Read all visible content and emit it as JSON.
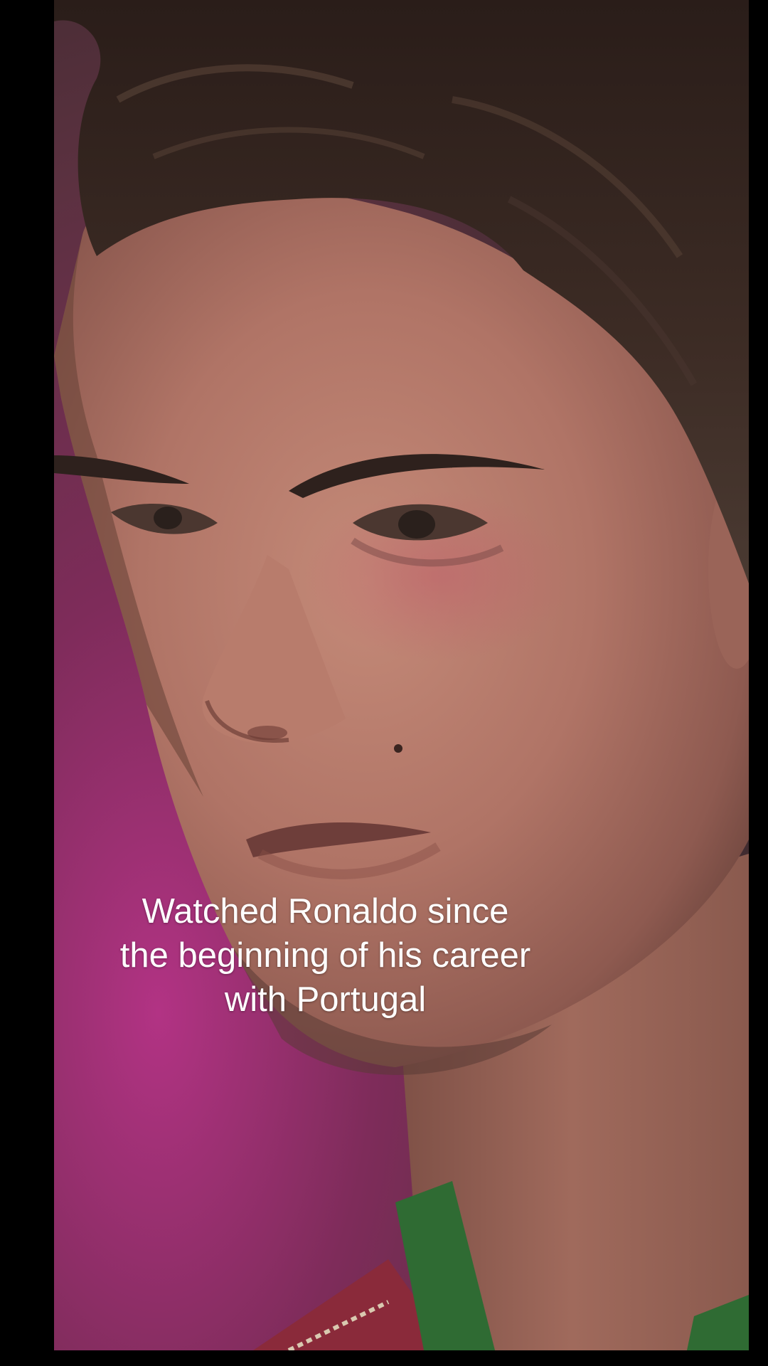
{
  "video": {
    "caption_lines": [
      "Watched Ronaldo since",
      "the beginning of his career",
      "with Portugal"
    ]
  },
  "colors": {
    "background": "#000000",
    "caption_text": "#ffffff",
    "backdrop_magenta": "#a8307a",
    "skin": "#b98070",
    "hair": "#3a2a24",
    "jersey_green": "#2f6b33",
    "jersey_red": "#8a2a3a"
  }
}
